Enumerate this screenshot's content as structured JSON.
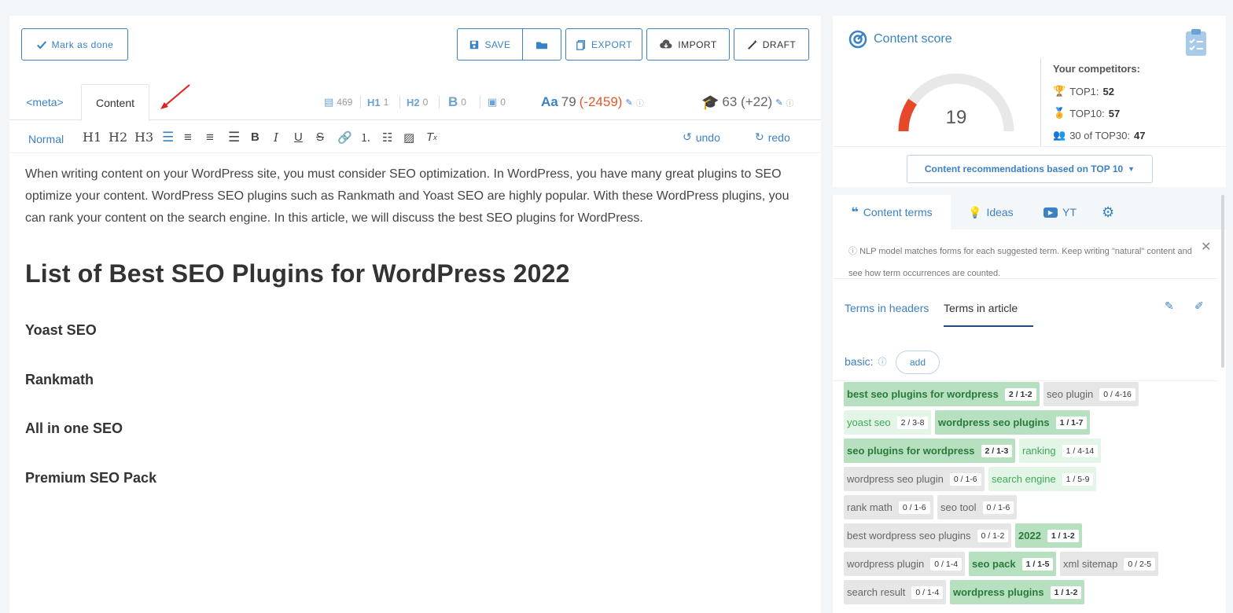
{
  "toolbar": {
    "mark_done": "Mark as done",
    "save": "SAVE",
    "export": "EXPORT",
    "import": "IMPORT",
    "draft": "DRAFT"
  },
  "tabs": {
    "meta": "<meta>",
    "content": "Content"
  },
  "stats": {
    "words_icon_value": "469",
    "h1": "1",
    "h2": "0",
    "bold": "0",
    "images": "0",
    "aa_value": "79",
    "aa_delta": "(-2459)",
    "grade_value": "63 (+22)"
  },
  "format_bar": {
    "normal": "Normal",
    "h1": "H1",
    "h2": "H2",
    "h3": "H3",
    "undo": "undo",
    "redo": "redo"
  },
  "article": {
    "intro": "When writing content on your WordPress site, you must consider SEO optimization. In WordPress, you have many great plugins to SEO optimize your content. WordPress SEO plugins such as Rankmath and Yoast SEO are highly popular. With these WordPress plugins, you can rank your content on the search engine. In this article, we will discuss the best SEO plugins for WordPress.",
    "heading": "List of Best SEO Plugins for WordPress 2022",
    "subheadings": [
      "Yoast SEO",
      "Rankmath",
      "All in one SEO",
      "Premium SEO Pack"
    ]
  },
  "score": {
    "title": "Content score",
    "value": "19",
    "gauge_fraction": 0.19,
    "competitors_title": "Your competitors:",
    "top1_label": "TOP1:",
    "top1_value": "52",
    "top10_label": "TOP10:",
    "top10_value": "57",
    "top30_label": "30 of TOP30:",
    "top30_value": "47",
    "recommend": "Content recommendations based on TOP 10"
  },
  "terms_panel": {
    "tabs": [
      "Content terms",
      "Ideas",
      "YT"
    ],
    "info": "NLP model matches forms for each suggested term. Keep writing \"natural\" content and see how term occurrences are counted.",
    "subtab_headers": "Terms in headers",
    "subtab_article": "Terms in article",
    "basic_label": "basic:",
    "add_label": "add",
    "terms": [
      {
        "text": "best seo plugins for wordpress",
        "count": "2 / 1-2",
        "style": "dark"
      },
      {
        "text": "seo plugin",
        "count": "0 / 4-16",
        "style": "grey"
      },
      {
        "text": "yoast seo",
        "count": "2 / 3-8",
        "style": "light"
      },
      {
        "text": "wordpress seo plugins",
        "count": "1 / 1-7",
        "style": "dark"
      },
      {
        "text": "seo plugins for wordpress",
        "count": "2 / 1-3",
        "style": "dark"
      },
      {
        "text": "ranking",
        "count": "1 / 4-14",
        "style": "light"
      },
      {
        "text": "wordpress seo plugin",
        "count": "0 / 1-6",
        "style": "grey"
      },
      {
        "text": "search engine",
        "count": "1 / 5-9",
        "style": "light"
      },
      {
        "text": "rank math",
        "count": "0 / 1-6",
        "style": "grey"
      },
      {
        "text": "seo tool",
        "count": "0 / 1-6",
        "style": "grey"
      },
      {
        "text": "best wordpress seo plugins",
        "count": "0 / 1-2",
        "style": "grey"
      },
      {
        "text": "2022",
        "count": "1 / 1-2",
        "style": "dark"
      },
      {
        "text": "wordpress plugin",
        "count": "0 / 1-4",
        "style": "grey"
      },
      {
        "text": "seo pack",
        "count": "1 / 1-5",
        "style": "dark"
      },
      {
        "text": "xml sitemap",
        "count": "0 / 2-5",
        "style": "grey"
      },
      {
        "text": "search result",
        "count": "0 / 1-4",
        "style": "grey"
      },
      {
        "text": "wordpress plugins",
        "count": "1 / 1-2",
        "style": "dark"
      }
    ]
  },
  "colors": {
    "accent": "#3b82c4",
    "negative": "#e25a2c",
    "gauge_fill": "#e8482a"
  }
}
